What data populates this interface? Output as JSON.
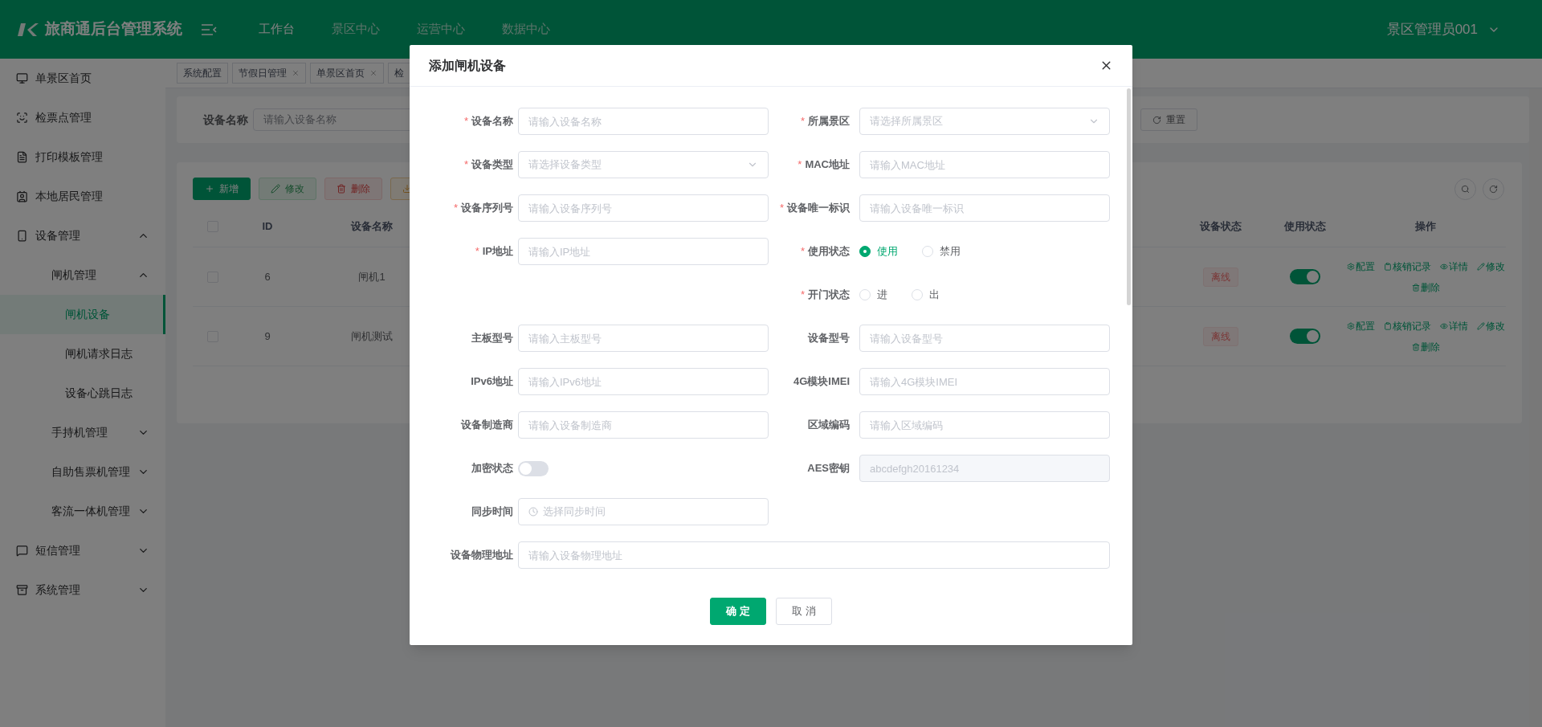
{
  "header": {
    "title": "旅商通后台管理系统",
    "nav": [
      {
        "label": "工作台",
        "selected": true
      },
      {
        "label": "景区中心",
        "selected": false
      },
      {
        "label": "运营中心",
        "selected": false
      },
      {
        "label": "数据中心",
        "selected": false
      }
    ],
    "user": "景区管理员001"
  },
  "sidebar": {
    "items": [
      {
        "label": "单景区首页",
        "selected": false
      },
      {
        "label": "检票点管理",
        "selected": false
      },
      {
        "label": "打印模板管理",
        "selected": false
      },
      {
        "label": "本地居民管理",
        "selected": false
      },
      {
        "label": "设备管理",
        "selected": false,
        "expanded": true,
        "children": [
          {
            "label": "闸机管理",
            "selected": false,
            "expanded": true,
            "children": [
              {
                "label": "闸机设备",
                "selected": true
              },
              {
                "label": "闸机请求日志",
                "selected": false
              },
              {
                "label": "设备心跳日志",
                "selected": false
              }
            ]
          },
          {
            "label": "手持机管理",
            "selected": false,
            "expanded": false
          },
          {
            "label": "自助售票机管理",
            "selected": false,
            "expanded": false
          },
          {
            "label": "客流一体机管理",
            "selected": false,
            "expanded": false
          }
        ]
      },
      {
        "label": "短信管理",
        "selected": false,
        "expanded": false
      },
      {
        "label": "系统管理",
        "selected": false,
        "expanded": false
      }
    ]
  },
  "tabs": [
    {
      "label": "系统配置",
      "closable": false
    },
    {
      "label": "节假日管理",
      "closable": true
    },
    {
      "label": "单景区首页",
      "closable": true
    },
    {
      "label": "检",
      "closable": false
    }
  ],
  "search": {
    "label": "设备名称",
    "placeholder": "请输入设备名称",
    "reset": "重置"
  },
  "toolbar": [
    {
      "label": "新增",
      "kind": "add"
    },
    {
      "label": "修改",
      "kind": "edit"
    },
    {
      "label": "删除",
      "kind": "delete"
    },
    {
      "kind": "export"
    }
  ],
  "table": {
    "all_checked": false,
    "columns": [
      "ID",
      "设备名称",
      "设备状态",
      "使用状态",
      "操作"
    ],
    "rows": [
      {
        "id": "6",
        "name": "闸机1",
        "status": "离线",
        "checked": false,
        "enabled": true,
        "actions": [
          {
            "label": "配置",
            "kind": "config"
          },
          {
            "label": "核销记录",
            "kind": "record"
          },
          {
            "label": "详情",
            "kind": "view"
          },
          {
            "label": "修改",
            "kind": "edit"
          },
          {
            "label": "删除",
            "kind": "delete"
          }
        ]
      },
      {
        "id": "9",
        "name": "闸机测试",
        "status": "离线",
        "checked": false,
        "enabled": true,
        "actions": [
          {
            "label": "配置",
            "kind": "config"
          },
          {
            "label": "核销记录",
            "kind": "record"
          },
          {
            "label": "详情",
            "kind": "view"
          },
          {
            "label": "修改",
            "kind": "edit"
          },
          {
            "label": "删除",
            "kind": "delete"
          }
        ]
      }
    ]
  },
  "modal": {
    "title": "添加闸机设备",
    "fields": [
      {
        "label": "设备名称",
        "required_mark": "*",
        "kind": "input",
        "placeholder": "请输入设备名称"
      },
      {
        "label": "所属景区",
        "required_mark": "*",
        "kind": "select",
        "placeholder": "请选择所属景区"
      },
      {
        "label": "设备类型",
        "required_mark": "*",
        "kind": "select",
        "placeholder": "请选择设备类型"
      },
      {
        "label": "MAC地址",
        "required_mark": "*",
        "kind": "input",
        "placeholder": "请输入MAC地址"
      },
      {
        "label": "设备序列号",
        "required_mark": "*",
        "kind": "input",
        "placeholder": "请输入设备序列号"
      },
      {
        "label": "设备唯一标识",
        "required_mark": "*",
        "kind": "input",
        "placeholder": "请输入设备唯一标识"
      },
      {
        "label": "IP地址",
        "required_mark": "*",
        "kind": "input",
        "placeholder": "请输入IP地址"
      },
      {
        "label": "使用状态",
        "required_mark": "*",
        "kind": "radio",
        "options": [
          {
            "label": "使用",
            "selected": true
          },
          {
            "label": "禁用",
            "selected": false
          }
        ]
      },
      {
        "label": "开门状态",
        "required_mark": "*",
        "kind": "radio",
        "options": [
          {
            "label": "进",
            "selected": false
          },
          {
            "label": "出",
            "selected": false
          }
        ]
      },
      {
        "label": "主板型号",
        "kind": "input",
        "placeholder": "请输入主板型号"
      },
      {
        "label": "设备型号",
        "kind": "input",
        "placeholder": "请输入设备型号"
      },
      {
        "label": "IPv6地址",
        "kind": "input",
        "placeholder": "请输入IPv6地址"
      },
      {
        "label": "4G模块IMEI",
        "kind": "input",
        "placeholder": "请输入4G模块IMEI"
      },
      {
        "label": "设备制造商",
        "kind": "input",
        "placeholder": "请输入设备制造商"
      },
      {
        "label": "区域编码",
        "kind": "input",
        "placeholder": "请输入区域编码"
      },
      {
        "label": "加密状态",
        "kind": "switch",
        "on": false
      },
      {
        "label": "AES密钥",
        "kind": "input",
        "value": "abcdefgh20161234",
        "disabled": true
      },
      {
        "label": "同步时间",
        "kind": "time",
        "placeholder": "选择同步时间"
      },
      {
        "label": "设备物理地址",
        "kind": "input",
        "placeholder": "请输入设备物理地址"
      }
    ],
    "buttons": [
      {
        "label": "确定",
        "kind": "primary"
      },
      {
        "label": "取消",
        "kind": "default"
      }
    ]
  }
}
